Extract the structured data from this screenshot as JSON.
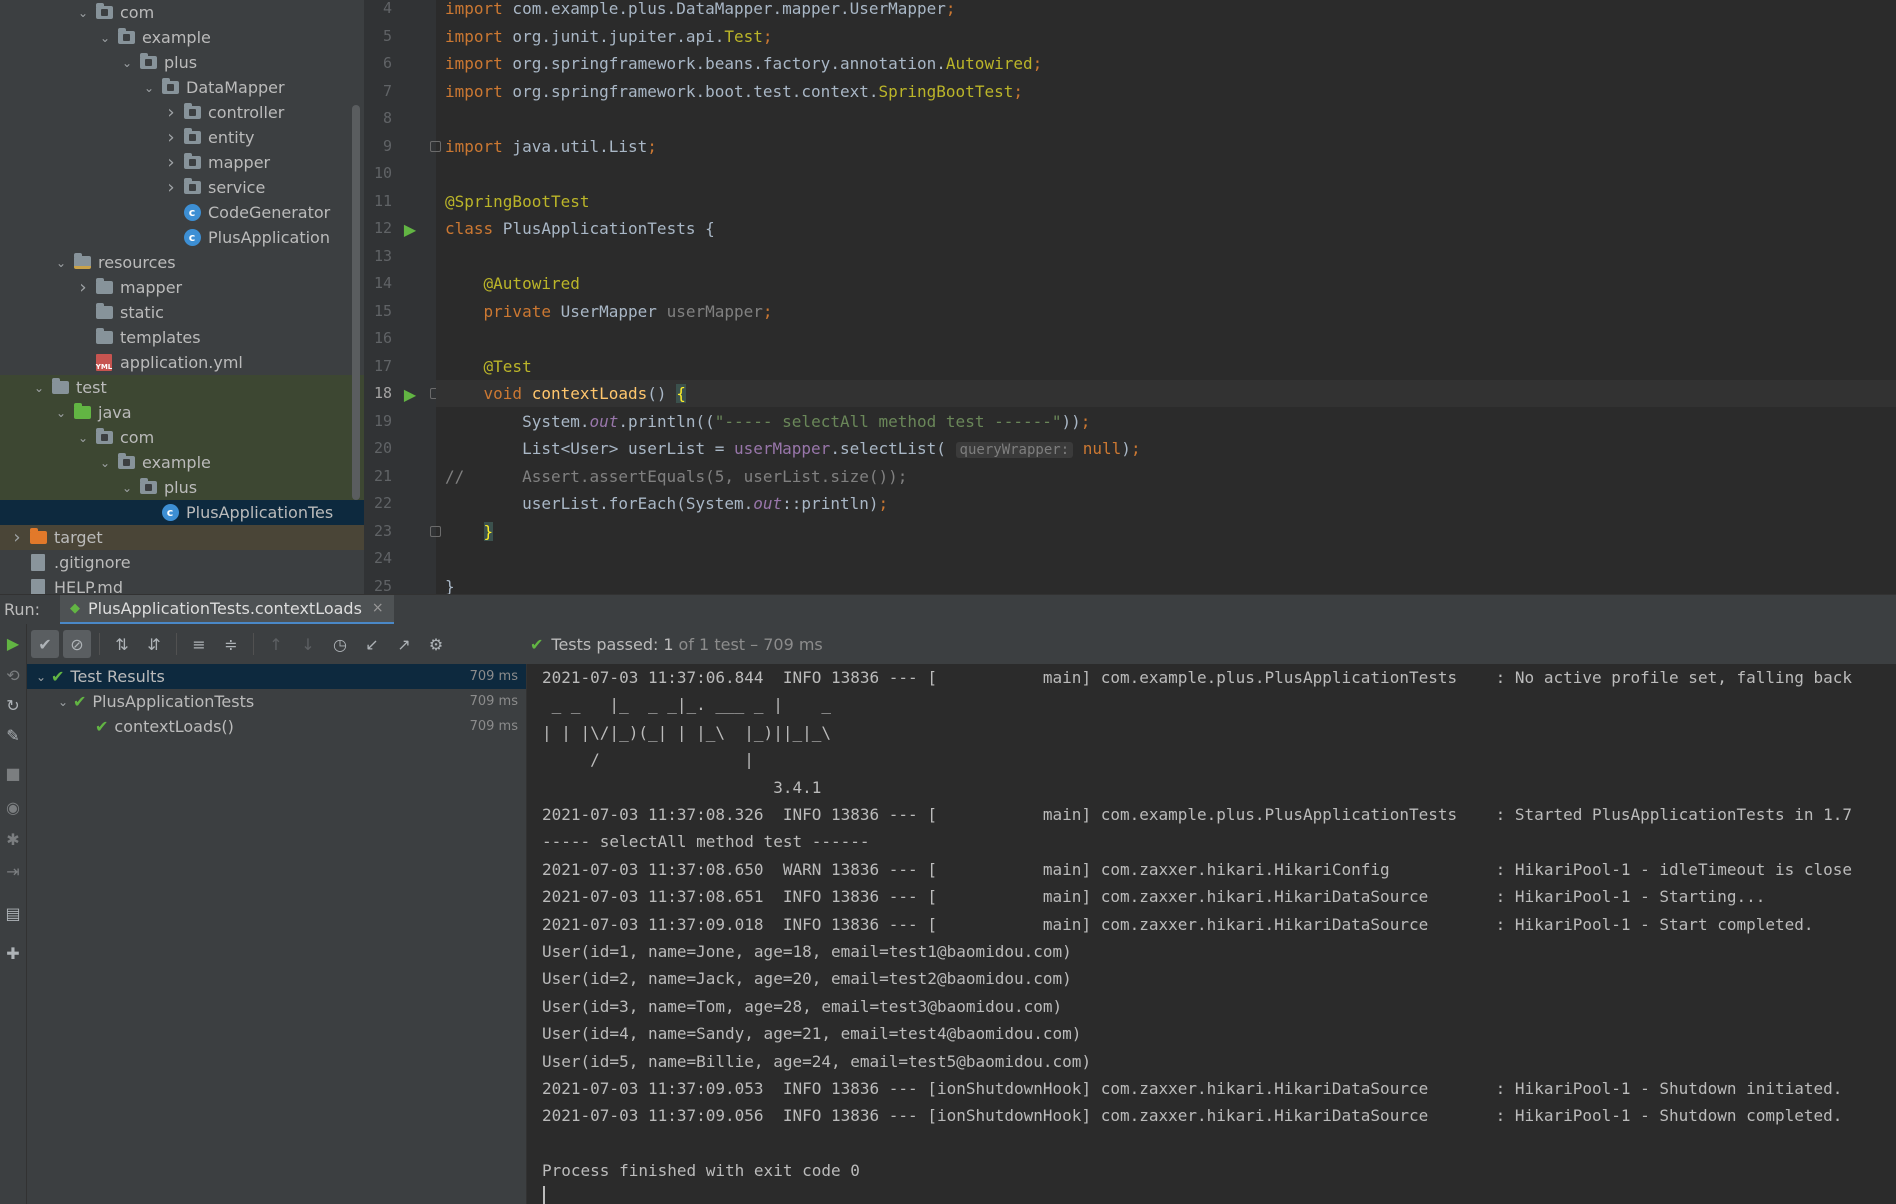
{
  "project_tree": {
    "items": [
      {
        "label": "com",
        "type": "package",
        "expanded": true
      },
      {
        "label": "example",
        "type": "package",
        "expanded": true
      },
      {
        "label": "plus",
        "type": "package",
        "expanded": true
      },
      {
        "label": "DataMapper",
        "type": "package",
        "expanded": true
      },
      {
        "label": "controller",
        "type": "package",
        "expanded": false
      },
      {
        "label": "entity",
        "type": "package",
        "expanded": false
      },
      {
        "label": "mapper",
        "type": "package",
        "expanded": false
      },
      {
        "label": "service",
        "type": "package",
        "expanded": false
      },
      {
        "label": "CodeGenerator",
        "type": "class"
      },
      {
        "label": "PlusApplication",
        "type": "class"
      },
      {
        "label": "resources",
        "type": "resources-folder",
        "expanded": true
      },
      {
        "label": "mapper",
        "type": "folder",
        "expanded": false
      },
      {
        "label": "static",
        "type": "folder"
      },
      {
        "label": "templates",
        "type": "folder"
      },
      {
        "label": "application.yml",
        "type": "yml"
      },
      {
        "label": "test",
        "type": "folder",
        "expanded": true
      },
      {
        "label": "java",
        "type": "test-source-root",
        "expanded": true
      },
      {
        "label": "com",
        "type": "package",
        "expanded": true
      },
      {
        "label": "example",
        "type": "package",
        "expanded": true
      },
      {
        "label": "plus",
        "type": "package",
        "expanded": true
      },
      {
        "label": "PlusApplicationTes",
        "type": "class",
        "selected": true
      },
      {
        "label": "target",
        "type": "excluded-folder",
        "expanded": false
      },
      {
        "label": ".gitignore",
        "type": "file"
      },
      {
        "label": "HELP.md",
        "type": "file"
      }
    ]
  },
  "editor": {
    "lines": [
      {
        "n": "4",
        "html": "<span class=\"kw\">import</span> com.example.plus.DataMapper.mapper.UserMapper<span class=\"kw\">;</span>"
      },
      {
        "n": "5",
        "html": "<span class=\"kw\">import</span> org.junit.jupiter.api.<span class=\"ann\">Test</span><span class=\"kw\">;</span>"
      },
      {
        "n": "6",
        "html": "<span class=\"kw\">import</span> org.springframework.beans.factory.annotation.<span class=\"ann\">Autowired</span><span class=\"kw\">;</span>"
      },
      {
        "n": "7",
        "html": "<span class=\"kw\">import</span> org.springframework.boot.test.context.<span class=\"ann\">SpringBootTest</span><span class=\"kw\">;</span>"
      },
      {
        "n": "8",
        "html": ""
      },
      {
        "n": "9",
        "html": "<span class=\"kw\">import</span> java.util.List<span class=\"kw\">;</span>"
      },
      {
        "n": "10",
        "html": ""
      },
      {
        "n": "11",
        "html": "<span class=\"ann\">@SpringBootTest</span>"
      },
      {
        "n": "12",
        "html": "<span class=\"kw\">class</span> PlusApplicationTests {"
      },
      {
        "n": "13",
        "html": ""
      },
      {
        "n": "14",
        "html": "    <span class=\"ann\">@Autowired</span>"
      },
      {
        "n": "15",
        "html": "    <span class=\"kw\">private</span> UserMapper <span class=\"unused\">userMapper</span><span class=\"kw\">;</span>"
      },
      {
        "n": "16",
        "html": ""
      },
      {
        "n": "17",
        "html": "    <span class=\"ann\">@Test</span>"
      },
      {
        "n": "18",
        "html": "    <span class=\"kw\">void</span> <span class=\"fn\">contextLoads</span>() <span class=\"brace-hl\">{</span>"
      },
      {
        "n": "19",
        "html": "        System.<span class=\"ital\">out</span>.println((<span class=\"str\">\"----- selectAll method test ------\"</span>))<span class=\"kw\">;</span>"
      },
      {
        "n": "20",
        "html": "        List&lt;User&gt; userList = <span class=\"fld\">userMapper</span>.selectList( <span class=\"hint\">queryWrapper:</span> <span class=\"kw\">null</span>)<span class=\"kw\">;</span>"
      },
      {
        "n": "21",
        "html": "<span class=\"cmt\">//      Assert.assertEquals(5, userList.size());</span>"
      },
      {
        "n": "22",
        "html": "        userList.forEach(System.<span class=\"ital\">out</span>::println)<span class=\"kw\">;</span>"
      },
      {
        "n": "23",
        "html": "    <span class=\"brace-hl\">}</span>"
      },
      {
        "n": "24",
        "html": ""
      },
      {
        "n": "25",
        "html": "}"
      }
    ]
  },
  "run_panel": {
    "label": "Run:",
    "tab_label": "PlusApplicationTests.contextLoads",
    "tab_close": "×",
    "status_prefix": "Tests passed:",
    "status_count": "1",
    "status_detail": "of 1 test – 709 ms"
  },
  "test_results": [
    {
      "label": "Test Results",
      "time": "709 ms",
      "depth": 0,
      "expanded": true,
      "selected": true
    },
    {
      "label": "PlusApplicationTests",
      "time": "709 ms",
      "depth": 1,
      "expanded": true
    },
    {
      "label": "contextLoads()",
      "time": "709 ms",
      "depth": 2
    }
  ],
  "console": [
    "2021-07-03 11:37:06.844  INFO 13836 --- [           main] com.example.plus.PlusApplicationTests    : No active profile set, falling back",
    " _ _   |_  _ _|_. ___ _ |    _",
    "| | |\\/|_)(_| | |_\\  |_)||_|_\\",
    "     /               |",
    "                        3.4.1",
    "2021-07-03 11:37:08.326  INFO 13836 --- [           main] com.example.plus.PlusApplicationTests    : Started PlusApplicationTests in 1.7",
    "----- selectAll method test ------",
    "2021-07-03 11:37:08.650  WARN 13836 --- [           main] com.zaxxer.hikari.HikariConfig           : HikariPool-1 - idleTimeout is close",
    "2021-07-03 11:37:08.651  INFO 13836 --- [           main] com.zaxxer.hikari.HikariDataSource       : HikariPool-1 - Starting...",
    "2021-07-03 11:37:09.018  INFO 13836 --- [           main] com.zaxxer.hikari.HikariDataSource       : HikariPool-1 - Start completed.",
    "User(id=1, name=Jone, age=18, email=test1@baomidou.com)",
    "User(id=2, name=Jack, age=20, email=test2@baomidou.com)",
    "User(id=3, name=Tom, age=28, email=test3@baomidou.com)",
    "User(id=4, name=Sandy, age=21, email=test4@baomidou.com)",
    "User(id=5, name=Billie, age=24, email=test5@baomidou.com)",
    "2021-07-03 11:37:09.053  INFO 13836 --- [ionShutdownHook] com.zaxxer.hikari.HikariDataSource       : HikariPool-1 - Shutdown initiated.",
    "2021-07-03 11:37:09.056  INFO 13836 --- [ionShutdownHook] com.zaxxer.hikari.HikariDataSource       : HikariPool-1 - Shutdown completed.",
    "",
    "Process finished with exit code 0"
  ],
  "colors": {
    "accent": "#4a88c7",
    "success": "#62b543",
    "keyword": "#cc7832",
    "annotation": "#bbb529",
    "string": "#6a8759"
  }
}
